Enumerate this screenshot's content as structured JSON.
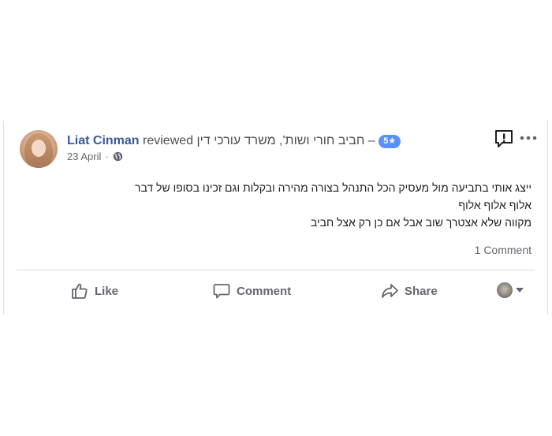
{
  "post": {
    "author": "Liat Cinman",
    "action": "reviewed",
    "page_name": "חביב חורי ושות', משרד עורכי דין",
    "separator": "–",
    "rating": "5★",
    "date": "23 April",
    "dot": "·",
    "text_lines": [
      "ייצג אותי בתביעה מול מעסיק הכל התנהל בצורה מהירה ובקלות וגם זכינו בסופו של דבר",
      "אלוף אלוף אלוף",
      "מקווה שלא אצטרך שוב אבל אם כן רק אצל חביב"
    ],
    "comments_count": "1 Comment"
  },
  "actions": {
    "like_label": "Like",
    "comment_label": "Comment",
    "share_label": "Share"
  },
  "icons": {
    "report": "report-exclamation-icon",
    "more": "more-dots-icon",
    "globe": "globe-icon",
    "like": "thumbs-up-icon",
    "comment": "speech-bubble-icon",
    "share": "share-arrow-icon"
  },
  "colors": {
    "author": "#385898",
    "rating_badge": "#5890ff",
    "action_text": "#606770"
  }
}
